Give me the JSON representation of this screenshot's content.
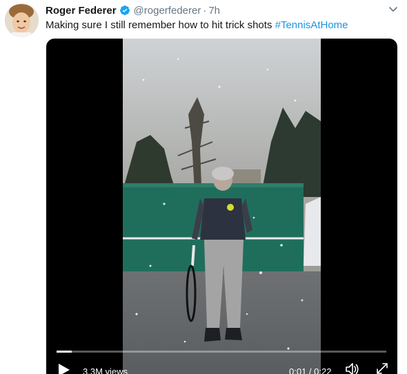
{
  "tweet": {
    "author_name": "Roger Federer",
    "author_handle": "@rogerfederer",
    "separator": "·",
    "time": "7h",
    "text": "Making sure I still remember how to hit trick shots ",
    "hashtag": "#TennisAtHome",
    "verified_icon": "verified-badge-icon",
    "menu_icon": "chevron-down-icon"
  },
  "video": {
    "views": "3.3M views",
    "time_display": "0:01 / 0:22",
    "progress": 0.045,
    "play_icon": "play-icon",
    "volume_icon": "volume-icon",
    "fullscreen_icon": "fullscreen-icon"
  },
  "colors": {
    "link": "#1b95e0",
    "verified": "#1da1f2",
    "secondary_text": "#657786",
    "primary_text": "#14171a"
  }
}
